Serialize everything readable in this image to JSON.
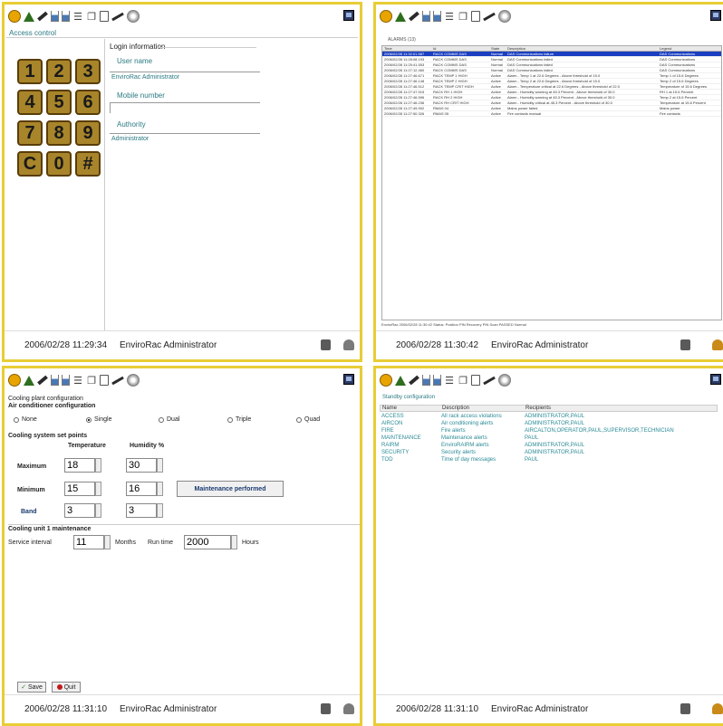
{
  "status": {
    "user": "EnviroRac Administrator",
    "times": [
      "2006/02/28 11:29:34",
      "2006/02/28 11:30:42",
      "2006/02/28 11:31:10",
      "2006/02/28 11:31:10"
    ]
  },
  "access": {
    "title": "Access control",
    "login_title": "Login information",
    "username_label": "User name",
    "username_value": "EnviroRac Administrator",
    "mobile_label": "Mobile number",
    "mobile_value": "",
    "authority_label": "Authority",
    "authority_value": "Administrator",
    "keys": [
      "1",
      "2",
      "3",
      "4",
      "5",
      "6",
      "7",
      "8",
      "9",
      "C",
      "0",
      "#"
    ]
  },
  "alarms": {
    "tab": "ALARMS (13)",
    "headers": [
      "Time",
      "Id",
      "State",
      "Description",
      "Legend"
    ],
    "rows": [
      [
        "2006/02/28 11:32:01.587",
        "RACK COMMS DAS",
        "Normal",
        "DAS Communications failure",
        "DAS Communications"
      ],
      [
        "2006/02/28 11:28:08.193",
        "RACK COMMS DAS",
        "Normal",
        "DAS Communications failed",
        "DAS Communications"
      ],
      [
        "2006/02/28 11:25:41.553",
        "RACK COMMS DAS",
        "Normal",
        "DAS Communications failed",
        "DAS Communications"
      ],
      [
        "2006/02/28 11:27:12.460",
        "RACK COMMS DAS",
        "Normal",
        "DAS Communications failed",
        "DAS Communications"
      ],
      [
        "2006/02/28 11:27:46.671",
        "RACK TEMP 1 HIGH",
        "Active",
        "Alarm - Temp 1 at 22.6 Degrees - Above threshold of 15.0",
        "Temp 1 of 15.6 Degrees"
      ],
      [
        "2006/02/28 11:27:46.148",
        "RACK TEMP 2 HIGH",
        "Active",
        "Alarm - Temp 2 at 22.6 Degrees - Above threshold of 15.0",
        "Temp 2 of 15.6 Degrees"
      ],
      [
        "2006/02/28 11:27:46.512",
        "RACK TEMP CRIT HIGH",
        "Active",
        "Alarm - Temperature critical at 22.6 Degrees - Above threshold of 22.0",
        "Temperature of 15.6 Degrees"
      ],
      [
        "2006/02/28 11:27:47.915",
        "RACK RH 1 HIGH",
        "Active",
        "Alarm - Humidity warning at 45.3 Percent - Above threshold of 30.0",
        "RH 1 at 15.6 Percent"
      ],
      [
        "2006/02/28 11:27:46.596",
        "RACK RH 2 HIGH",
        "Active",
        "Alarm - Humidity warning at 45.3 Percent - Above threshold of 30.0",
        "Temp 2 at 15.6 Percent"
      ],
      [
        "2006/02/28 11:27:46.236",
        "RACK RH CRIT HIGH",
        "Active",
        "Alarm - Humidity critical at 45.3 Percent - Above threshold of 30.0",
        "Temperature at 15.6 Percent"
      ],
      [
        "2006/02/28 11:27:49.902",
        "RMAS 04",
        "Active",
        "Mains power failed",
        "Mains power"
      ],
      [
        "2006/02/28 11:27:50.326",
        "RMAS 05",
        "Active",
        "Fire contacts manual",
        "Fire contacts"
      ]
    ],
    "footer": "EnviroRac  2006/02/28 11:30:42  Status: Position PIN  Recovery PIN  Scan PASSED  Normal"
  },
  "cooling": {
    "title": "Cooling plant configuration",
    "ac_title": "Air conditioner configuration",
    "modes": [
      "None",
      "Single",
      "Dual",
      "Triple",
      "Quad"
    ],
    "selected_mode": "Single",
    "setpoints_title": "Cooling system set points",
    "temp_header": "Temperature",
    "hum_header": "Humidity %",
    "rows": [
      {
        "label": "Maximum",
        "temp": "18",
        "hum": "30"
      },
      {
        "label": "Minimum",
        "temp": "15",
        "hum": "16"
      },
      {
        "label": "Band",
        "temp": "3",
        "hum": "3"
      }
    ],
    "maint_button": "Maintenance performed",
    "maint_title": "Cooling unit 1 maintenance",
    "service_label": "Service interval",
    "service_value": "11",
    "months_label": "Months",
    "runtime_label": "Run time",
    "runtime_value": "2000",
    "hours_label": "Hours",
    "save_label": "Save",
    "quit_label": "Quit"
  },
  "users": {
    "title": "Standby configuration",
    "headers": [
      "Name",
      "Description",
      "Recipients"
    ],
    "rows": [
      [
        "ACCESS",
        "All rack access violations",
        "ADMINISTRATOR,PAUL"
      ],
      [
        "AIRCON",
        "Air conditioning alerts",
        "ADMINISTRATOR,PAUL"
      ],
      [
        "FIRE",
        "Fire alerts",
        "AIRCALTON,OPERATOR,PAUL,SUPERVISOR,TECHNICIAN"
      ],
      [
        "MAINTENANCE",
        "Maintenance alerts",
        "PAUL"
      ],
      [
        "RAIRM",
        "EnviroRAIRM alerts",
        "ADMINISTRATOR,PAUL"
      ],
      [
        "SECURITY",
        "Security alerts",
        "ADMINISTRATOR,PAUL"
      ],
      [
        "TOD",
        "Time of day messages",
        "PAUL"
      ]
    ]
  },
  "icons": [
    "logo-icon",
    "warning-icon",
    "pen-icon",
    "bar-icon",
    "chart-icon",
    "link-icon",
    "copy-icon",
    "bin-icon",
    "tool-icon",
    "globe-icon"
  ]
}
